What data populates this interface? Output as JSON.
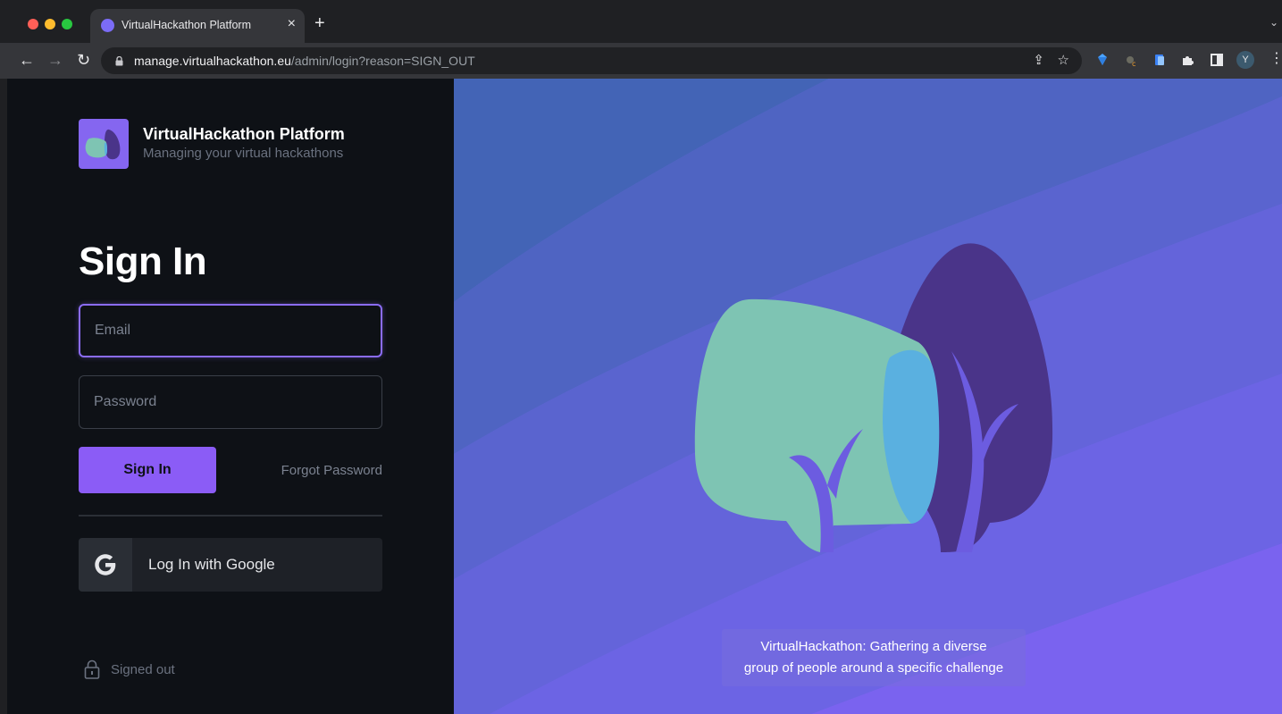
{
  "browser": {
    "tab_title": "VirtualHackathon Platform",
    "url_host": "manage.virtualhackathon.eu",
    "url_path": "/admin/login?reason=SIGN_OUT",
    "profile_initial": "Y",
    "icons": [
      "back-arrow-icon",
      "forward-arrow-icon",
      "reload-icon",
      "lock-icon",
      "share-icon",
      "star-icon",
      "puzzle-icon",
      "sidebar-icon",
      "kebab-menu-icon"
    ]
  },
  "brand": {
    "name": "VirtualHackathon Platform",
    "tagline": "Managing your virtual hackathons",
    "color": "#8566f0"
  },
  "form": {
    "heading": "Sign In",
    "email_placeholder": "Email",
    "password_placeholder": "Password",
    "submit_label": "Sign In",
    "forgot_label": "Forgot Password",
    "google_label": "Log In with Google"
  },
  "status": {
    "text": "Signed out"
  },
  "hero": {
    "caption_line1": "VirtualHackathon: Gathering a diverse",
    "caption_line2": "group of people around a specific challenge"
  },
  "colors": {
    "accent": "#8b5cf6",
    "panel_bg": "#0e1116",
    "leaf_green": "#7ec4b3",
    "leaf_purple": "#4a3489",
    "leaf_overlap": "#5ab0e0"
  }
}
